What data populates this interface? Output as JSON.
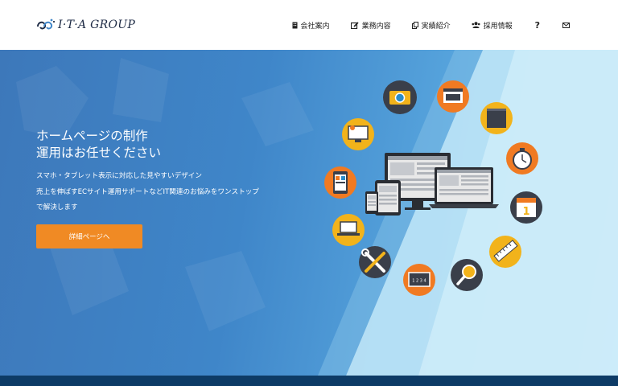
{
  "brand": {
    "name": "I·T·A GROUP"
  },
  "nav": {
    "items": [
      {
        "label": "会社案内",
        "icon": "building-icon"
      },
      {
        "label": "業務内容",
        "icon": "edit-icon"
      },
      {
        "label": "実績紹介",
        "icon": "copy-icon"
      },
      {
        "label": "採用情報",
        "icon": "users-icon"
      },
      {
        "label": "?",
        "icon": "question-icon"
      },
      {
        "label": "",
        "icon": "mail-icon"
      }
    ]
  },
  "hero": {
    "title_line1": "ホームページの制作",
    "title_line2": "運用はお任せください",
    "sub_line1": "スマホ・タブレット表示に対応した見やすいデザイン",
    "sub_line2": "売上を伸ばすECサイト運用サポートなどIT関連のお悩みをワンストップ",
    "sub_line3": "で解決します",
    "cta_label": "詳細ページへ"
  },
  "colors": {
    "accent": "#f08a24",
    "hero_blue": "#3f86c9",
    "footer": "#0d3b66",
    "icon_dark": "#3a3f4a"
  },
  "hero_icons": [
    "camera-icon",
    "browser-icon",
    "book-icon",
    "monitor-icon",
    "stopwatch-icon",
    "mobile-layout-icon",
    "calendar-icon",
    "laptop-icon",
    "ruler-icon",
    "tools-icon",
    "magnifier-icon",
    "chalkboard-icon"
  ],
  "calendar_day": "1",
  "chalkboard_text": "1 2 3 4"
}
